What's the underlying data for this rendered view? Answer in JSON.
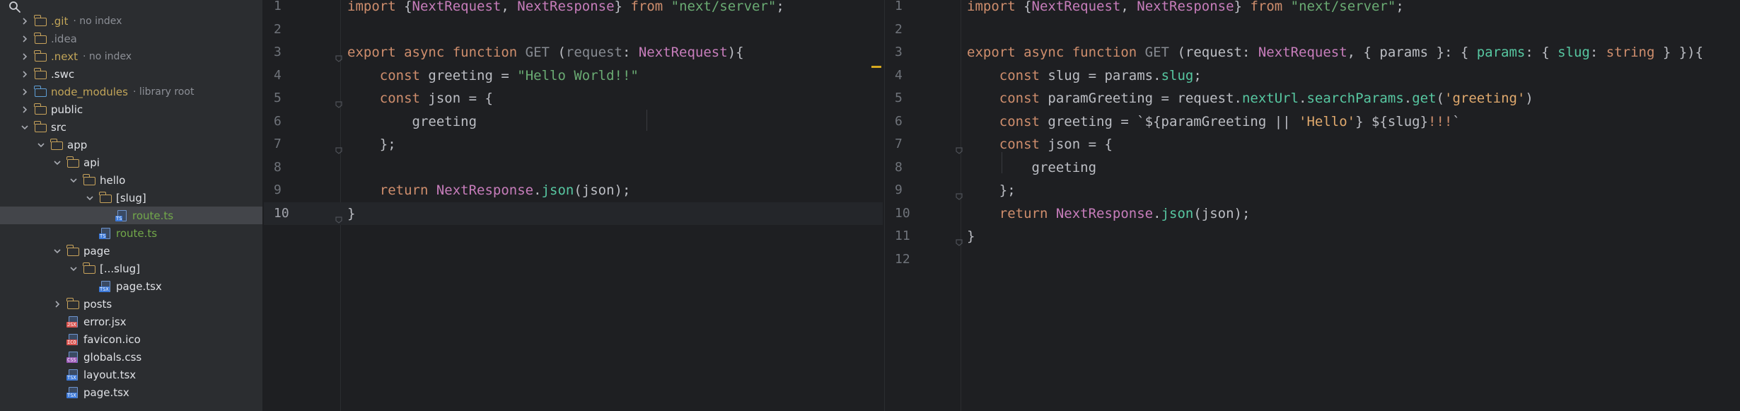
{
  "project_tree": {
    "items": [
      {
        "name": ".git",
        "suffix": "· no index",
        "type": "folder",
        "depth": 0,
        "expanded": false,
        "status": "ignored"
      },
      {
        "name": ".idea",
        "suffix": "",
        "type": "folder",
        "depth": 0,
        "expanded": false,
        "status": "muted"
      },
      {
        "name": ".next",
        "suffix": "· no index",
        "type": "folder",
        "depth": 0,
        "expanded": false,
        "status": "ignored"
      },
      {
        "name": ".swc",
        "suffix": "",
        "type": "folder",
        "depth": 0,
        "expanded": false,
        "status": "normal"
      },
      {
        "name": "node_modules",
        "suffix": "· library root",
        "type": "folder-lib",
        "depth": 0,
        "expanded": false,
        "status": "ignored"
      },
      {
        "name": "public",
        "suffix": "",
        "type": "folder",
        "depth": 0,
        "expanded": false,
        "status": "normal"
      },
      {
        "name": "src",
        "suffix": "",
        "type": "folder",
        "depth": 0,
        "expanded": true,
        "status": "normal"
      },
      {
        "name": "app",
        "suffix": "",
        "type": "folder",
        "depth": 1,
        "expanded": true,
        "status": "normal"
      },
      {
        "name": "api",
        "suffix": "",
        "type": "folder",
        "depth": 2,
        "expanded": true,
        "status": "normal"
      },
      {
        "name": "hello",
        "suffix": "",
        "type": "folder",
        "depth": 3,
        "expanded": true,
        "status": "normal"
      },
      {
        "name": "[slug]",
        "suffix": "",
        "type": "folder",
        "depth": 4,
        "expanded": true,
        "status": "normal"
      },
      {
        "name": "route.ts",
        "suffix": "",
        "type": "file-ts",
        "depth": 5,
        "status": "modified",
        "selected": true
      },
      {
        "name": "route.ts",
        "suffix": "",
        "type": "file-ts",
        "depth": 4,
        "status": "modified"
      },
      {
        "name": "page",
        "suffix": "",
        "type": "folder",
        "depth": 2,
        "expanded": true,
        "status": "normal"
      },
      {
        "name": "[...slug]",
        "suffix": "",
        "type": "folder",
        "depth": 3,
        "expanded": true,
        "status": "normal"
      },
      {
        "name": "page.tsx",
        "suffix": "",
        "type": "file-tsx",
        "depth": 4,
        "status": "normal"
      },
      {
        "name": "posts",
        "suffix": "",
        "type": "folder",
        "depth": 2,
        "expanded": false,
        "status": "normal"
      },
      {
        "name": "error.jsx",
        "suffix": "",
        "type": "file-jsx",
        "depth": 2,
        "status": "normal"
      },
      {
        "name": "favicon.ico",
        "suffix": "",
        "type": "file-ico",
        "depth": 2,
        "status": "normal"
      },
      {
        "name": "globals.css",
        "suffix": "",
        "type": "file-css",
        "depth": 2,
        "status": "normal"
      },
      {
        "name": "layout.tsx",
        "suffix": "",
        "type": "file-tsx",
        "depth": 2,
        "status": "normal"
      },
      {
        "name": "page.tsx",
        "suffix": "",
        "type": "file-tsx",
        "depth": 2,
        "status": "normal"
      }
    ]
  },
  "editor_left": {
    "inspection": {
      "warnings": "2"
    },
    "lines": [
      [
        [
          "import ",
          "kw"
        ],
        [
          "{",
          ""
        ],
        [
          "NextRequest",
          "type"
        ],
        [
          ", ",
          ""
        ],
        [
          "NextResponse",
          "type"
        ],
        [
          "} ",
          ""
        ],
        [
          "from ",
          "kw"
        ],
        [
          "\"next/server\"",
          "str"
        ],
        [
          ";",
          ""
        ]
      ],
      [],
      [
        [
          "export ",
          "kw"
        ],
        [
          "async ",
          "kw"
        ],
        [
          "function ",
          "kw"
        ],
        [
          "GET ",
          "grey"
        ],
        [
          "(",
          ""
        ],
        [
          "request",
          "grey"
        ],
        [
          ": ",
          ""
        ],
        [
          "NextRequest",
          "type"
        ],
        [
          "){",
          ""
        ]
      ],
      [
        [
          "    ",
          ""
        ],
        [
          "const ",
          "kw"
        ],
        [
          "greeting = ",
          ""
        ],
        [
          "\"Hello World!!\"",
          "str"
        ]
      ],
      [
        [
          "    ",
          ""
        ],
        [
          "const ",
          "kw"
        ],
        [
          "json = {",
          ""
        ]
      ],
      [
        [
          "        greeting",
          ""
        ]
      ],
      [
        [
          "    };",
          ""
        ]
      ],
      [],
      [
        [
          "    ",
          ""
        ],
        [
          "return ",
          "kw"
        ],
        [
          "NextResponse",
          "type"
        ],
        [
          ".",
          ""
        ],
        [
          "json",
          "method"
        ],
        [
          "(json);",
          ""
        ]
      ],
      [
        [
          "}",
          ""
        ]
      ]
    ]
  },
  "editor_right": {
    "lines": [
      [
        [
          "import ",
          "kw"
        ],
        [
          "{",
          ""
        ],
        [
          "NextRequest",
          "type"
        ],
        [
          ", ",
          ""
        ],
        [
          "NextResponse",
          "type"
        ],
        [
          "} ",
          ""
        ],
        [
          "from ",
          "kw"
        ],
        [
          "\"next/server\"",
          "str"
        ],
        [
          ";",
          ""
        ]
      ],
      [],
      [
        [
          "export ",
          "kw"
        ],
        [
          "async ",
          "kw"
        ],
        [
          "function ",
          "kw"
        ],
        [
          "GET ",
          "grey"
        ],
        [
          "(request: ",
          ""
        ],
        [
          "NextRequest",
          "type"
        ],
        [
          ", { params }: { ",
          ""
        ],
        [
          "params",
          "method"
        ],
        [
          ": { ",
          ""
        ],
        [
          "slug",
          "method"
        ],
        [
          ": ",
          ""
        ],
        [
          "string",
          "kw"
        ],
        [
          " } }){",
          ""
        ]
      ],
      [
        [
          "    ",
          ""
        ],
        [
          "const ",
          "kw"
        ],
        [
          "slug = params.",
          ""
        ],
        [
          "slug",
          "method"
        ],
        [
          ";",
          ""
        ]
      ],
      [
        [
          "    ",
          ""
        ],
        [
          "const ",
          "kw"
        ],
        [
          "paramGreeting = request.",
          ""
        ],
        [
          "nextUrl",
          "method"
        ],
        [
          ".",
          ""
        ],
        [
          "searchParams",
          "method"
        ],
        [
          ".",
          ""
        ],
        [
          "get",
          "method"
        ],
        [
          "(",
          ""
        ],
        [
          "'greeting'",
          "strd"
        ],
        [
          ")",
          ""
        ]
      ],
      [
        [
          "    ",
          ""
        ],
        [
          "const ",
          "kw"
        ],
        [
          "greeting = `${paramGreeting || ",
          ""
        ],
        [
          "'Hello'",
          "strd"
        ],
        [
          "} ${slug}",
          ""
        ],
        [
          "!!!",
          "kw"
        ],
        [
          "`",
          ""
        ]
      ],
      [
        [
          "    ",
          ""
        ],
        [
          "const ",
          "kw"
        ],
        [
          "json = {",
          ""
        ]
      ],
      [
        [
          "        greeting",
          ""
        ]
      ],
      [
        [
          "    };",
          ""
        ]
      ],
      [
        [
          "    ",
          ""
        ],
        [
          "return ",
          "kw"
        ],
        [
          "NextResponse",
          "type"
        ],
        [
          ".",
          ""
        ],
        [
          "json",
          "method"
        ],
        [
          "(json);",
          ""
        ]
      ],
      [
        [
          "}",
          ""
        ]
      ],
      []
    ]
  },
  "colors": {
    "kw": "#cf8e6d",
    "type": "#c77dbb",
    "str": "#6aab73",
    "strd": "#e0a96d",
    "method": "#57c7a1",
    "grey": "#868a91",
    "warning": "#d6a81f"
  }
}
